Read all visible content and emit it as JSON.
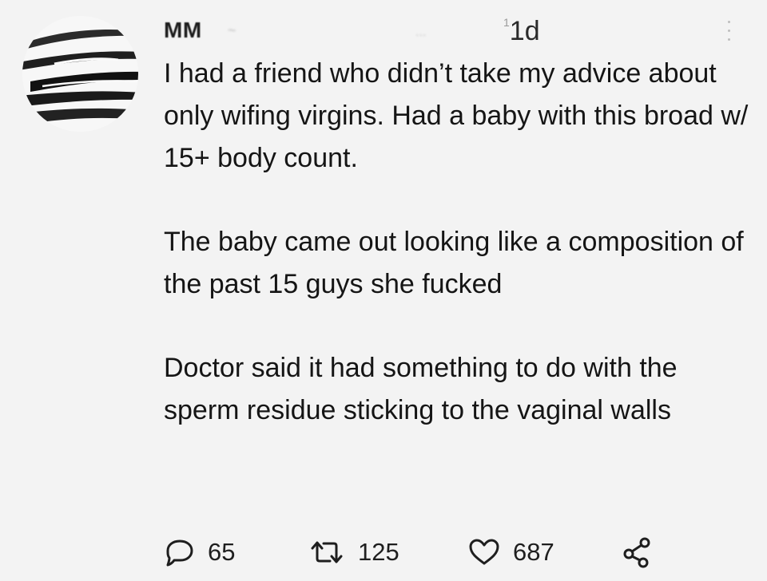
{
  "tweet": {
    "author_name": "MM",
    "author_handle": "~",
    "meta_blurred": "...",
    "time": "1d",
    "time_prefix": "1",
    "paragraphs": [
      "I had a friend who didn’t take my advice about only wifing virgins. Had a baby with this broad w/ 15+ body count.",
      "The baby came out looking like a composition of the past 15 guys she fucked",
      "Doctor said it had something to do with the sperm residue sticking to the vaginal walls"
    ],
    "stats": {
      "replies": "65",
      "retweets": "125",
      "likes": "687"
    }
  },
  "icons": {
    "reply": "reply-icon",
    "retweet": "retweet-icon",
    "like": "heart-icon",
    "share": "share-icon",
    "more": "more-vertical-icon"
  },
  "colors": {
    "background": "#f3f3f3",
    "text": "#151515",
    "icon": "#1e1e1e",
    "muted": "#bdbdbd"
  }
}
